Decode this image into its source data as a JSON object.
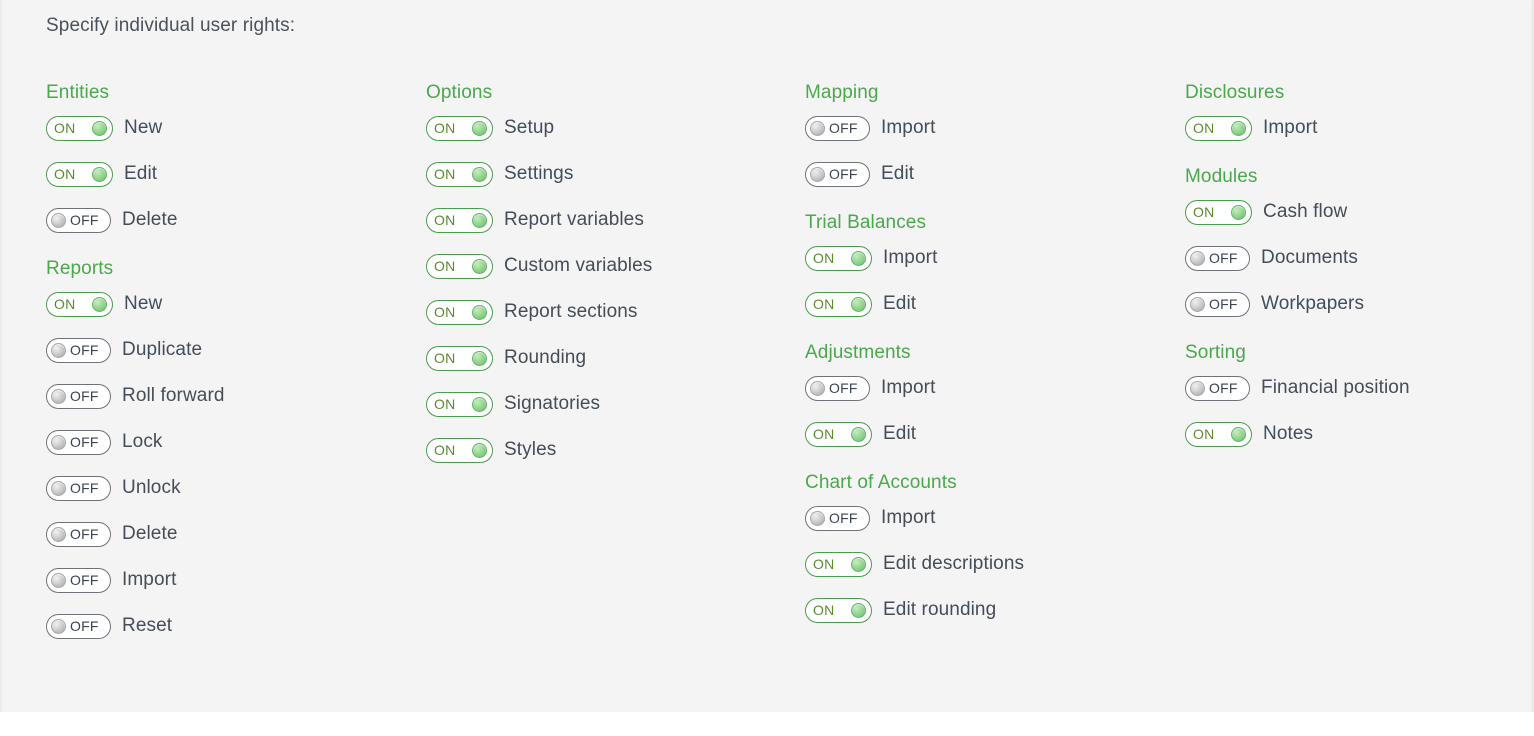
{
  "page": {
    "intro_text": "Specify individual user rights:",
    "background_color": "#f4f4f4",
    "group_title_color": "#4ba84d",
    "label_color": "#454d57",
    "toggle_on_border_color": "#4a9d4f",
    "toggle_off_border_color": "#6f7379",
    "toggle_on_text": "ON",
    "toggle_off_text": "OFF"
  },
  "columns": [
    {
      "groups": [
        {
          "title": "Entities",
          "items": [
            {
              "label": "New",
              "state": "ON",
              "state_text": "ON"
            },
            {
              "label": "Edit",
              "state": "ON",
              "state_text": "ON"
            },
            {
              "label": "Delete",
              "state": "OFF",
              "state_text": "OFF"
            }
          ]
        },
        {
          "title": "Reports",
          "items": [
            {
              "label": "New",
              "state": "ON",
              "state_text": "ON"
            },
            {
              "label": "Duplicate",
              "state": "OFF",
              "state_text": "OFF"
            },
            {
              "label": "Roll forward",
              "state": "OFF",
              "state_text": "OFF"
            },
            {
              "label": "Lock",
              "state": "OFF",
              "state_text": "OFF"
            },
            {
              "label": "Unlock",
              "state": "OFF",
              "state_text": "OFF"
            },
            {
              "label": "Delete",
              "state": "OFF",
              "state_text": "OFF"
            },
            {
              "label": "Import",
              "state": "OFF",
              "state_text": "OFF"
            },
            {
              "label": "Reset",
              "state": "OFF",
              "state_text": "OFF"
            }
          ]
        }
      ]
    },
    {
      "groups": [
        {
          "title": "Options",
          "items": [
            {
              "label": "Setup",
              "state": "ON",
              "state_text": "ON"
            },
            {
              "label": "Settings",
              "state": "ON",
              "state_text": "ON"
            },
            {
              "label": "Report variables",
              "state": "ON",
              "state_text": "ON"
            },
            {
              "label": "Custom variables",
              "state": "ON",
              "state_text": "ON"
            },
            {
              "label": "Report sections",
              "state": "ON",
              "state_text": "ON"
            },
            {
              "label": "Rounding",
              "state": "ON",
              "state_text": "ON"
            },
            {
              "label": "Signatories",
              "state": "ON",
              "state_text": "ON"
            },
            {
              "label": "Styles",
              "state": "ON",
              "state_text": "ON"
            }
          ]
        }
      ]
    },
    {
      "groups": [
        {
          "title": "Mapping",
          "items": [
            {
              "label": "Import",
              "state": "OFF",
              "state_text": "OFF"
            },
            {
              "label": "Edit",
              "state": "OFF",
              "state_text": "OFF"
            }
          ]
        },
        {
          "title": "Trial Balances",
          "items": [
            {
              "label": "Import",
              "state": "ON",
              "state_text": "ON"
            },
            {
              "label": "Edit",
              "state": "ON",
              "state_text": "ON"
            }
          ]
        },
        {
          "title": "Adjustments",
          "items": [
            {
              "label": "Import",
              "state": "OFF",
              "state_text": "OFF"
            },
            {
              "label": "Edit",
              "state": "ON",
              "state_text": "ON"
            }
          ]
        },
        {
          "title": "Chart of Accounts",
          "items": [
            {
              "label": "Import",
              "state": "OFF",
              "state_text": "OFF"
            },
            {
              "label": "Edit descriptions",
              "state": "ON",
              "state_text": "ON"
            },
            {
              "label": "Edit rounding",
              "state": "ON",
              "state_text": "ON"
            }
          ]
        }
      ]
    },
    {
      "groups": [
        {
          "title": "Disclosures",
          "items": [
            {
              "label": "Import",
              "state": "ON",
              "state_text": "ON"
            }
          ]
        },
        {
          "title": "Modules",
          "items": [
            {
              "label": "Cash flow",
              "state": "ON",
              "state_text": "ON"
            },
            {
              "label": "Documents",
              "state": "OFF",
              "state_text": "OFF"
            },
            {
              "label": "Workpapers",
              "state": "OFF",
              "state_text": "OFF"
            }
          ]
        },
        {
          "title": "Sorting",
          "items": [
            {
              "label": "Financial position",
              "state": "OFF",
              "state_text": "OFF"
            },
            {
              "label": "Notes",
              "state": "ON",
              "state_text": "ON"
            }
          ]
        }
      ]
    }
  ]
}
